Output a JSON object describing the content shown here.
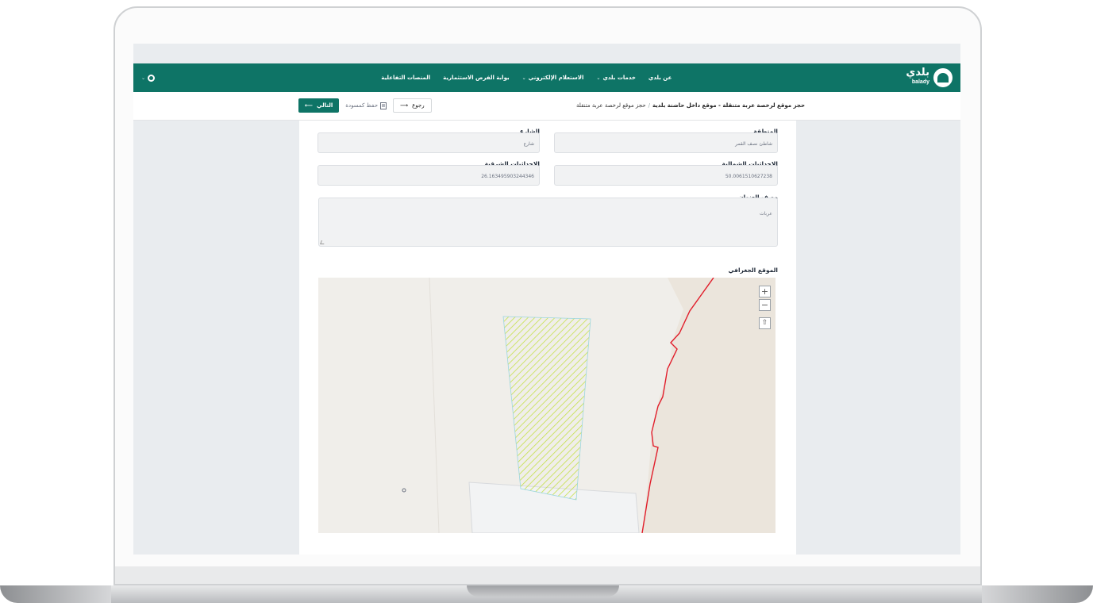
{
  "header": {
    "logo_text": "بلدي",
    "logo_sub": "balady",
    "nav": [
      {
        "label": "عن بلدي",
        "has_menu": false
      },
      {
        "label": "خدمات بلدي",
        "has_menu": true
      },
      {
        "label": "الاستعلام الإلكتروني",
        "has_menu": true
      },
      {
        "label": "بوابة الفرص الاستثمارية",
        "has_menu": false
      },
      {
        "label": "المنصات التفاعلية",
        "has_menu": false
      }
    ],
    "user_chevron": "⌄",
    "brand_color": "#0e7466"
  },
  "subbar": {
    "title": "حجز موقع لرخصة عربة متنقلة - موقع داخل حاضنة بلدية",
    "separator": "/",
    "crumb": "حجز موقع لرخصة عربة متنقلة",
    "next_label": "التالي",
    "next_arrow": "⟵",
    "draft_label": "حفظ كمسودة",
    "back_label": "رجوع",
    "back_arrow": "⟶"
  },
  "form": {
    "region_label": "المنطقة",
    "region_value": "شاطئ نصف القمر",
    "street_label": "الشارع",
    "street_value": "شارع",
    "north_label": "الاحداثيات الشمالية",
    "north_value": "50.0061510627238",
    "east_label": "الاحداثيات الشرقية",
    "east_value": "26.163495903244346",
    "address_label": "وصف العنوان",
    "address_value": "عربات",
    "geo_label": "الموقع الجغرافي"
  },
  "map": {
    "zoom_in": "+",
    "zoom_out": "−",
    "locate": "⇧",
    "boundary_color": "#e11d2a",
    "parcel_color": "#c5e14a"
  }
}
